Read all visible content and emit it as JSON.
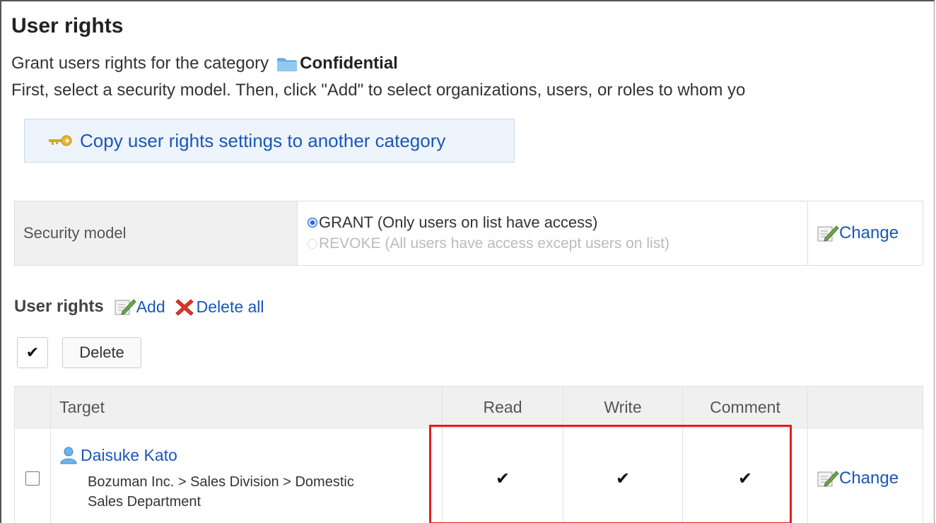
{
  "page": {
    "title": "User rights",
    "desc_prefix": "Grant users rights for the category",
    "category_name": "Confidential",
    "desc_line2": "First, select a security model. Then, click \"Add\" to select organizations, users, or roles to whom yo"
  },
  "copy_button": {
    "label": "Copy user rights settings to another category"
  },
  "security": {
    "label": "Security model",
    "grant_option": "GRANT (Only users on list have access)",
    "revoke_option": "REVOKE (All users have access except users on list)",
    "selected": "GRANT",
    "change_label": "Change"
  },
  "user_rights": {
    "heading": "User rights",
    "add_label": "Add",
    "delete_all_label": "Delete all",
    "select_all_symbol": "✔",
    "delete_label": "Delete"
  },
  "table": {
    "headers": [
      "",
      "Target",
      "Read",
      "Write",
      "Comment",
      ""
    ],
    "rows": [
      {
        "name": "Daisuke Kato",
        "org_line1": "Bozuman Inc. > Sales Division > Domestic",
        "org_line2": "Sales Department",
        "read": "✔",
        "write": "✔",
        "comment": "✔",
        "change_label": "Change",
        "checked": false
      }
    ]
  },
  "colors": {
    "link": "#1a57b8",
    "highlight": "#e0201b",
    "header_bg": "#f0f0f0",
    "copy_button_bg": "#eef4fb"
  },
  "icons": {
    "folder": "folder-icon",
    "key": "key-icon",
    "edit": "edit-icon",
    "delete": "delete-x-icon",
    "user": "user-icon"
  }
}
